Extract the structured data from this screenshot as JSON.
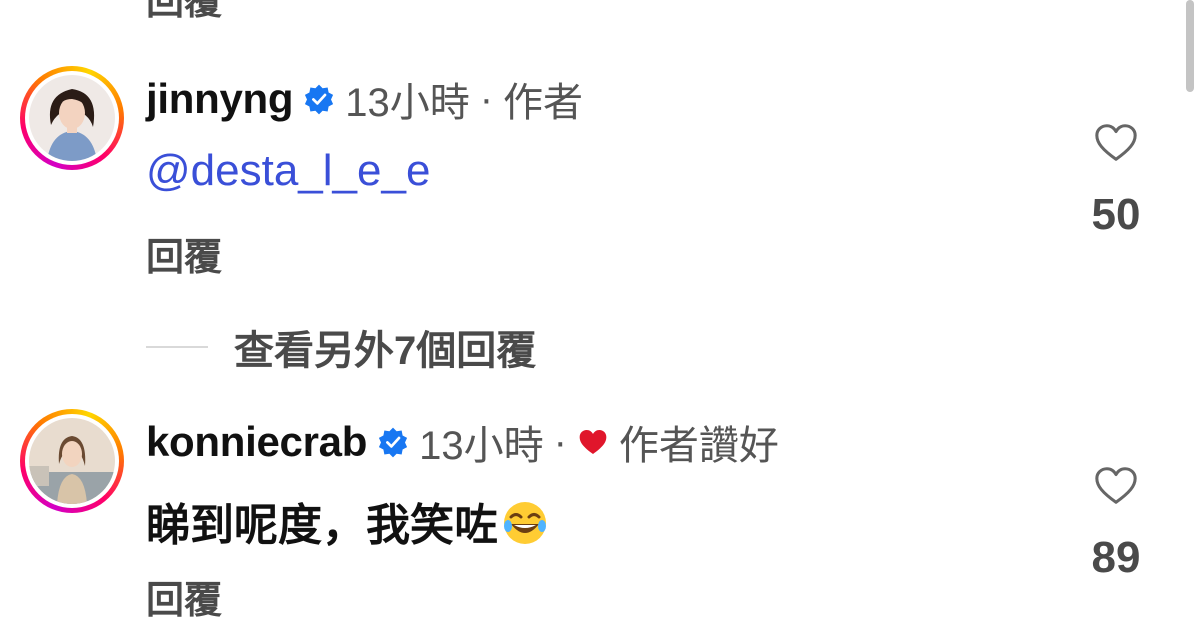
{
  "top_partial": {
    "reply_label": "回覆"
  },
  "comments": [
    {
      "username": "jinnyng",
      "verified": true,
      "time": "13小時",
      "separator": "·",
      "tag": "作者",
      "mention": "@desta_l_e_e",
      "reply_label": "回覆",
      "like_count": "50",
      "avatar_icon": "profile-photo"
    },
    {
      "username": "konniecrab",
      "verified": true,
      "time": "13小時",
      "separator": "·",
      "tag": "作者讚好",
      "text": "睇到呢度，我笑咗",
      "emoji": "😂",
      "reply_label": "回覆",
      "like_count": "89",
      "avatar_icon": "profile-photo"
    }
  ],
  "view_more": {
    "label": "查看另外7個回覆"
  },
  "colors": {
    "mention": "#3a4fd8",
    "verified": "#1877f2",
    "liked_heart": "#e0162b",
    "secondary_text": "#4a4a4a"
  },
  "icons": {
    "verified": "verified-badge-icon",
    "like": "heart-outline-icon",
    "author_liked": "heart-filled-icon"
  }
}
